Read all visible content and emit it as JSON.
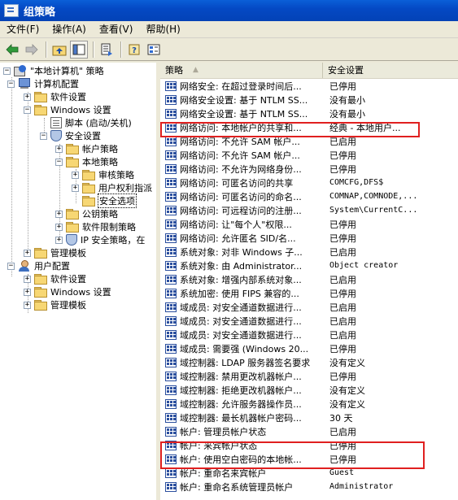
{
  "window": {
    "title": "组策略"
  },
  "menu": [
    "文件(F)",
    "操作(A)",
    "查看(V)",
    "帮助(H)"
  ],
  "toolbar": {
    "buttons": [
      "back-arrow-icon",
      "forward-arrow-icon",
      "up-folder-icon",
      "show-hide-tree-icon",
      "export-list-icon",
      "help-icon",
      "properties-icon"
    ]
  },
  "tree": {
    "root": "\"本地计算机\" 策略",
    "computer_config": "计算机配置",
    "software_settings": "软件设置",
    "windows_settings": "Windows 设置",
    "scripts": "脚本 (启动/关机)",
    "security_settings": "安全设置",
    "account_policies": "帐户策略",
    "local_policies": "本地策略",
    "audit_policy": "审核策略",
    "user_rights": "用户权利指派",
    "security_options": "安全选项",
    "public_key": "公钥策略",
    "software_restriction": "软件限制策略",
    "ip_security": "IP 安全策略，在",
    "admin_templates": "管理模板",
    "user_config": "用户配置",
    "user_software": "软件设置",
    "user_windows": "Windows 设置",
    "user_admin": "管理模板"
  },
  "list": {
    "col_policy": "策略",
    "col_setting": "安全设置",
    "rows": [
      {
        "policy": "网络安全: 在超过登录时间后...",
        "setting": "已停用"
      },
      {
        "policy": "网络安全设置: 基于 NTLM SS...",
        "setting": "没有最小"
      },
      {
        "policy": "网络安全设置: 基于 NTLM SS...",
        "setting": "没有最小"
      },
      {
        "policy": "网络访问: 本地帐户的共享和...",
        "setting": "经典 - 本地用户..."
      },
      {
        "policy": "网络访问: 不允许 SAM 帐户...",
        "setting": "已启用"
      },
      {
        "policy": "网络访问: 不允许 SAM 帐户...",
        "setting": "已停用"
      },
      {
        "policy": "网络访问: 不允许为网络身份...",
        "setting": "已停用"
      },
      {
        "policy": "网络访问: 可匿名访问的共享",
        "setting": "COMCFG,DFS$"
      },
      {
        "policy": "网络访问: 可匿名访问的命名...",
        "setting": "COMNAP,COMNODE,..."
      },
      {
        "policy": "网络访问: 可远程访问的注册...",
        "setting": "System\\CurrentC..."
      },
      {
        "policy": "网络访问: 让\"每个人\"权限...",
        "setting": "已停用"
      },
      {
        "policy": "网络访问: 允许匿名 SID/名...",
        "setting": "已停用"
      },
      {
        "policy": "系统对象: 对非 Windows 子...",
        "setting": "已启用"
      },
      {
        "policy": "系统对象: 由 Administrator...",
        "setting": "Object creator"
      },
      {
        "policy": "系统对象: 增强内部系统对象...",
        "setting": "已启用"
      },
      {
        "policy": "系统加密: 使用 FIPS 兼容的...",
        "setting": "已停用"
      },
      {
        "policy": "域成员: 对安全通道数据进行...",
        "setting": "已启用"
      },
      {
        "policy": "域成员: 对安全通道数据进行...",
        "setting": "已启用"
      },
      {
        "policy": "域成员: 对安全通道数据进行...",
        "setting": "已启用"
      },
      {
        "policy": "域成员: 需要强 (Windows 20...",
        "setting": "已停用"
      },
      {
        "policy": "域控制器: LDAP 服务器签名要求",
        "setting": "没有定义"
      },
      {
        "policy": "域控制器: 禁用更改机器帐户...",
        "setting": "已停用"
      },
      {
        "policy": "域控制器: 拒绝更改机器帐户...",
        "setting": "没有定义"
      },
      {
        "policy": "域控制器: 允许服务器操作员...",
        "setting": "没有定义"
      },
      {
        "policy": "域控制器: 最长机器帐户密码...",
        "setting": "30 天"
      },
      {
        "policy": "帐户: 管理员帐户状态",
        "setting": "已启用"
      },
      {
        "policy": "帐户: 来宾帐户状态",
        "setting": "已停用"
      },
      {
        "policy": "帐户: 使用空白密码的本地帐...",
        "setting": "已停用"
      },
      {
        "policy": "帐户: 重命名来宾帐户",
        "setting": "Guest"
      },
      {
        "policy": "帐户: 重命名系统管理员帐户",
        "setting": "Administrator"
      }
    ]
  },
  "colors": {
    "title_bar": "#0449c4",
    "highlight_box": "#e02020"
  }
}
